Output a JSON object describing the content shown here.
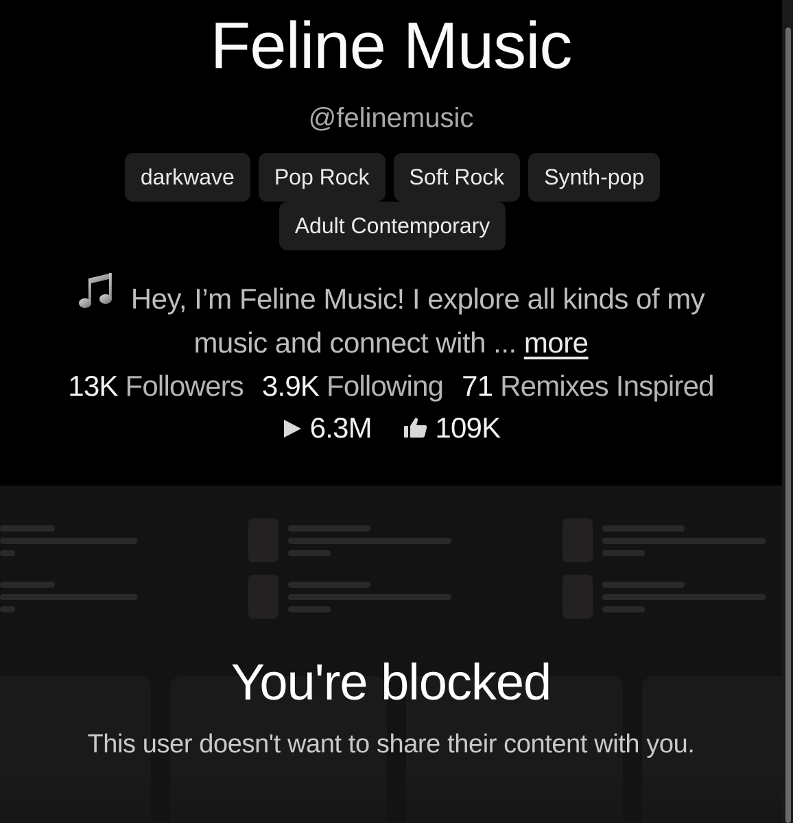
{
  "profile": {
    "name": "Feline Music",
    "handle": "@felinemusic",
    "genres": [
      "darkwave",
      "Pop Rock",
      "Soft Rock",
      "Synth-pop",
      "Adult Contemporary"
    ],
    "bio_icon": "music-note-icon",
    "bio_text": "Hey, I’m Feline Music! I explore all kinds of my music and connect with ...",
    "more_label": "more"
  },
  "stats": {
    "followers_count": "13K",
    "followers_label": "Followers",
    "following_count": "3.9K",
    "following_label": "Following",
    "remixes_count": "71",
    "remixes_label": "Remixes Inspired",
    "plays_icon": "play-icon",
    "plays": "6.3M",
    "likes_icon": "thumbs-up-icon",
    "likes": "109K"
  },
  "blocked": {
    "title": "You're blocked",
    "message": "This user doesn't want to share their content with you."
  },
  "colors": {
    "background": "#000000",
    "chip_background": "#1e1e1e",
    "muted_text": "#a9a9a9",
    "blocked_area": "#141313"
  }
}
